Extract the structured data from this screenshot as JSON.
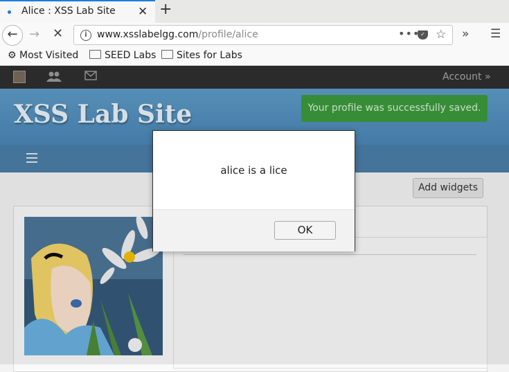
{
  "browser": {
    "tab_title": "Alice : XSS Lab Site",
    "tab_close": "✕",
    "new_tab": "+",
    "url_domain": "www.xsslabelgg.com",
    "url_path": "/profile/alice",
    "bookmarks": [
      "Most Visited",
      "SEED Labs",
      "Sites for Labs"
    ]
  },
  "site": {
    "title": "XSS Lab Site",
    "account_label": "Account »",
    "success_message": "Your profile was successfully saved.",
    "add_widgets_label": "Add widgets"
  },
  "dialog": {
    "message": "alice is a lice",
    "ok_label": "OK"
  },
  "icons": {
    "topbar": [
      "elgg-logo-icon",
      "friends-icon",
      "messages-icon"
    ],
    "toolbar": [
      "back-arrow-icon",
      "forward-arrow-icon",
      "stop-loading-icon",
      "page-info-icon",
      "page-actions-icon",
      "pocket-icon",
      "bookmark-star-icon",
      "overflow-chevron-icon",
      "hamburger-menu-icon"
    ]
  },
  "colors": {
    "tab_accent": "#1a7be0",
    "header_blue": "#5d9bc6",
    "success_green": "#3c9a3c",
    "topbar_dark": "#2f2f2f"
  }
}
